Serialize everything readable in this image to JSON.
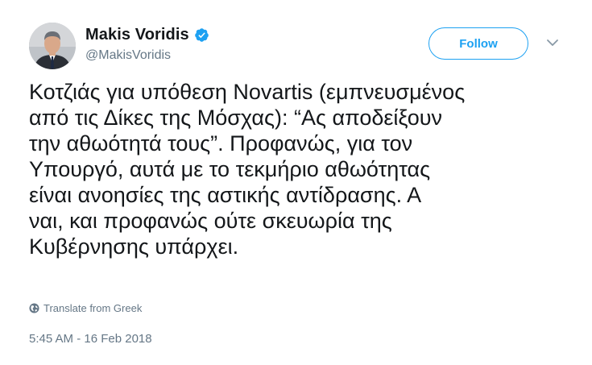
{
  "author": {
    "display_name": "Makis Voridis",
    "handle": "@MakisVoridis",
    "verified": true,
    "avatar_icon": "profile-photo"
  },
  "actions": {
    "follow_label": "Follow",
    "menu_icon": "chevron-down-icon"
  },
  "tweet": {
    "lines": [
      "Κοτζιάς για υπόθεση Novartis (εμπνευσμένος",
      "από τις Δίκες της Μόσχας): “Ας αποδείξουν",
      "την αθωότητά τους”. Προφανώς, για τον",
      "Υπουργό, αυτά με το τεκμήριο αθωότητας",
      "είναι ανοησίες της αστικής αντίδρασης. Α",
      "ναι, και προφανώς ούτε σκευωρία της",
      "Κυβέρνησης υπάρχει."
    ],
    "translate_label": "Translate from Greek",
    "timestamp": "5:45 AM - 16 Feb 2018"
  },
  "colors": {
    "accent": "#1da1f2",
    "secondary_text": "#657786",
    "primary_text": "#14171a"
  }
}
